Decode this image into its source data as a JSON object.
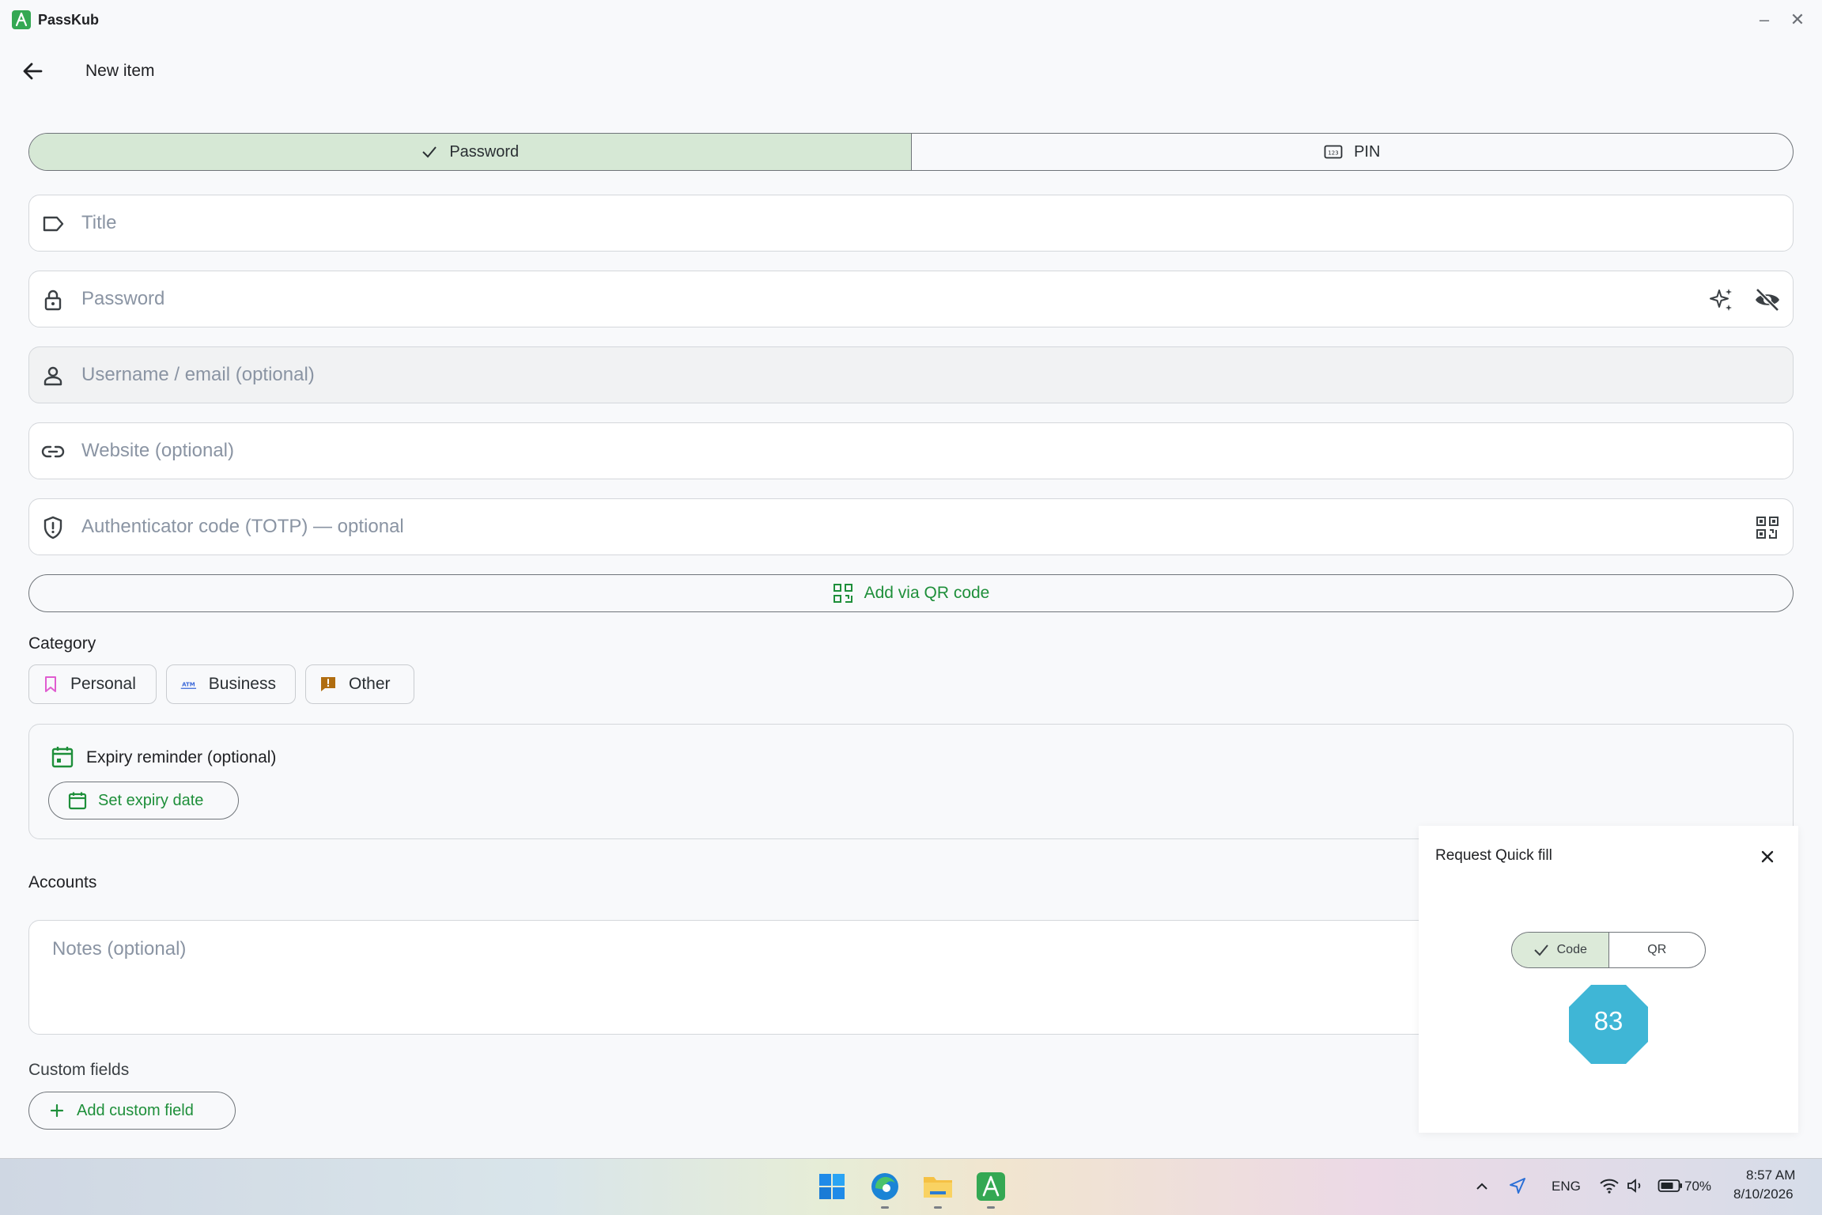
{
  "app": {
    "name": "PassKub"
  },
  "header": {
    "title": "New item"
  },
  "type_toggle": {
    "password_label": "Password",
    "pin_label": "PIN",
    "selected": "Password"
  },
  "fields": {
    "title_placeholder": "Title",
    "password_placeholder": "Password",
    "username_placeholder": "Username / email (optional)",
    "website_placeholder": "Website (optional)",
    "totp_placeholder": "Authenticator code (TOTP) — optional"
  },
  "qr_button": {
    "label": "Add via QR code"
  },
  "category": {
    "label": "Category",
    "chips": [
      {
        "label": "Personal",
        "icon": "bookmark-icon",
        "color": "#e05cd0"
      },
      {
        "label": "Business",
        "icon": "atm-card-icon",
        "color": "#3a67d8"
      },
      {
        "label": "Other",
        "icon": "alert-message-icon",
        "color": "#b06d10"
      }
    ]
  },
  "expiry": {
    "title": "Expiry reminder (optional)",
    "button_label": "Set expiry date"
  },
  "accounts": {
    "label": "Accounts"
  },
  "notes": {
    "placeholder": "Notes (optional)"
  },
  "custom_fields": {
    "label": "Custom fields",
    "button_label": "Add custom field"
  },
  "quick_fill": {
    "title": "Request Quick fill",
    "code_label": "Code",
    "qr_label": "QR",
    "selected": "Code",
    "badge_value": "83",
    "badge_color": "#3fb6d6"
  },
  "taskbar": {
    "language": "ENG",
    "battery": "70%",
    "time": "8:57 AM",
    "date": "8/10/2026"
  },
  "colors": {
    "accent": "#1e8f3a",
    "selected_segment": "#d6e8d5"
  }
}
